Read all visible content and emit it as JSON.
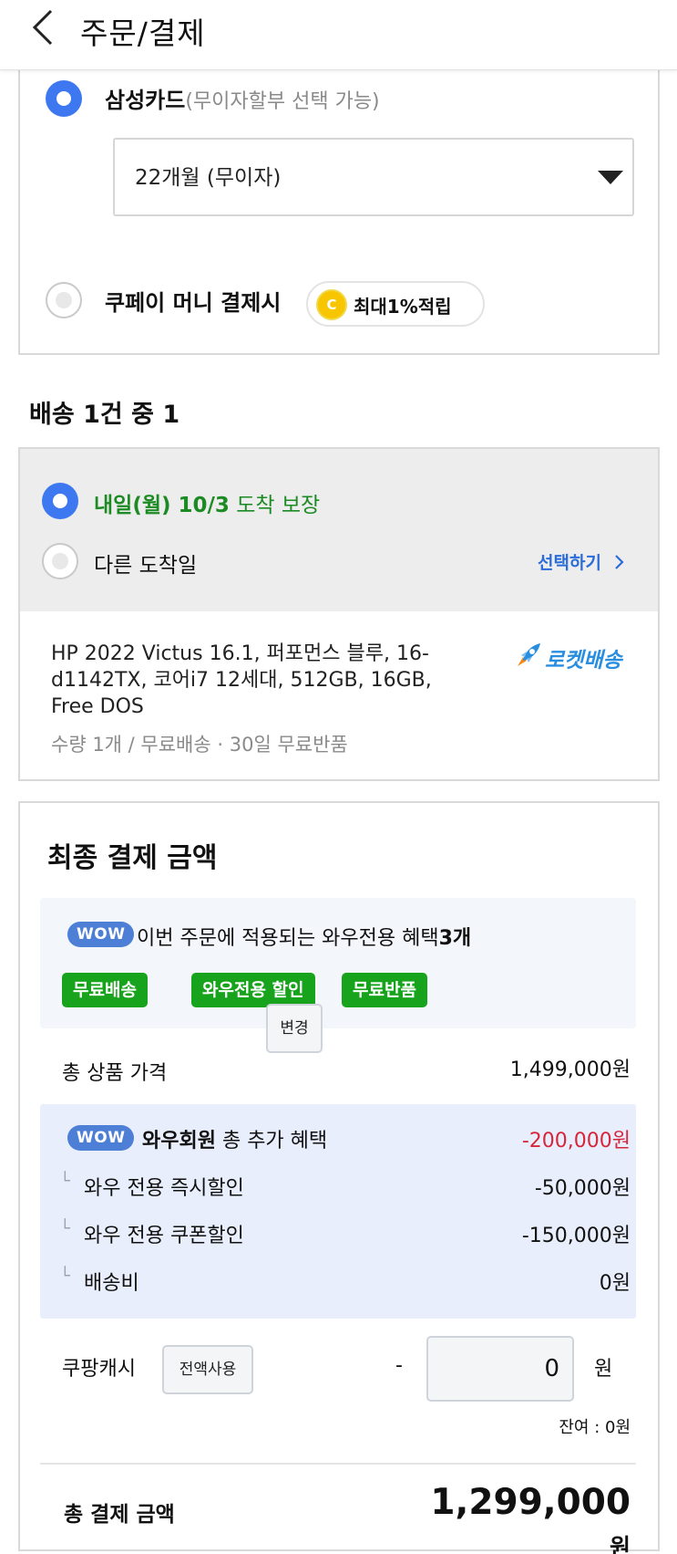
{
  "header": {
    "title": "주문/결제"
  },
  "payment": {
    "card_name": "삼성카드",
    "card_note": "(무이자할부 선택 가능)",
    "installment_selected": "22개월 (무이자)",
    "coupay_label": "쿠페이 머니 결제시",
    "coin_letter": "C",
    "coupay_badge": "최대1%적립"
  },
  "delivery": {
    "heading": "배송 1건 중 1",
    "option_main_bold": "내일(월) 10/3",
    "option_main_rest": " 도착 보장",
    "option_other": "다른 도착일",
    "select_link": "선택하기",
    "product_name": "HP 2022 Victus 16.1, 퍼포먼스 블루, 16-d1142TX, 코어i7 12세대, 512GB, 16GB, Free DOS",
    "product_meta": "수량 1개 / 무료배송 · 30일 무료반품",
    "rocket_label": "로켓배송"
  },
  "final": {
    "title": "최종 결제 금액",
    "wow_badge": "WOW",
    "wow_text": "이번 주문에 적용되는 와우전용 혜택",
    "wow_count": "3개",
    "tags": [
      "무료배송",
      "와우전용 할인",
      "무료반품"
    ],
    "total_product_label": "총 상품 가격",
    "total_product_value": "1,499,000원",
    "member_bold": "와우회원",
    "member_rest": " 총 추가 혜택",
    "member_total": "-200,000원",
    "rows": [
      {
        "label": "와우 전용 즉시할인",
        "value": "-50,000원"
      },
      {
        "label": "와우 전용 쿠폰할인",
        "value": "-150,000원"
      },
      {
        "label": "배송비",
        "value": "0원"
      }
    ],
    "branch_glyph": "└",
    "change_button": "변경",
    "cash_label": "쿠팡캐시",
    "use_all_button": "전액사용",
    "cash_minus": "-",
    "cash_value": "0",
    "cash_unit": "원",
    "balance": "잔여 : 0원",
    "grand_label": "총 결제 금액",
    "grand_value": "1,299,000",
    "grand_unit": "원"
  },
  "colors": {
    "accent_blue": "#3d78f0",
    "green": "#18a31c",
    "red": "#d6263b",
    "link_blue": "#2b6cd9",
    "wow_blue": "#4d7fd6"
  },
  "icons": [
    "back-icon",
    "dropdown-caret-icon",
    "coin-icon",
    "chevron-right-icon",
    "rocket-icon"
  ]
}
